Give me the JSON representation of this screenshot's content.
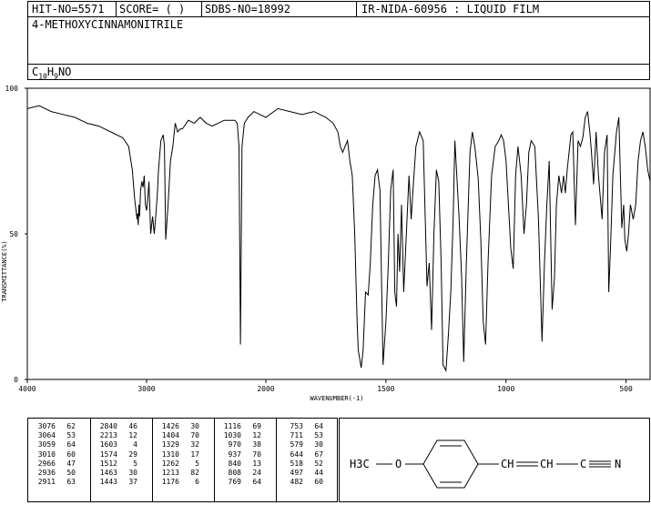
{
  "header": {
    "hit_no": "HIT-NO=5571",
    "score": "SCORE=  (   )",
    "sdbs_no": "SDBS-NO=18992",
    "ir_info": "IR-NIDA-60956 : LIQUID FILM",
    "compound_name": "4-METHOXYCINNAMONITRILE",
    "formula": {
      "c": "C",
      "c_n": "10",
      "h": "H",
      "h_n": "9",
      "rest": "NO"
    }
  },
  "chart_data": {
    "type": "line",
    "title": "",
    "xlabel": "WAVENUMBER(-1)",
    "ylabel": "TRANSMITTANCE(%)",
    "xlim": [
      4000,
      400
    ],
    "ylim": [
      0,
      100
    ],
    "x_ticks": [
      4000,
      3000,
      2000,
      1500,
      1000,
      500
    ],
    "y_ticks": [
      100,
      50,
      0
    ],
    "x_tick_labels": [
      "4000",
      "3000",
      "2000",
      "1500",
      "1000",
      "500"
    ],
    "y_tick_labels": [
      "100",
      "50",
      "0"
    ],
    "series": [
      {
        "x": [
          4000,
          3900,
          3800,
          3700,
          3600,
          3500,
          3400,
          3300,
          3200,
          3150,
          3120,
          3100,
          3080,
          3076,
          3070,
          3064,
          3059,
          3050,
          3040,
          3030,
          3020,
          3010,
          3000,
          2990,
          2980,
          2966,
          2960,
          2950,
          2936,
          2925,
          2911,
          2900,
          2880,
          2860,
          2850,
          2840,
          2820,
          2800,
          2780,
          2760,
          2740,
          2720,
          2700,
          2650,
          2600,
          2550,
          2500,
          2450,
          2400,
          2350,
          2300,
          2260,
          2240,
          2225,
          2213,
          2200,
          2180,
          2150,
          2100,
          2050,
          2000,
          1950,
          1900,
          1850,
          1800,
          1750,
          1720,
          1700,
          1690,
          1680,
          1670,
          1660,
          1650,
          1640,
          1630,
          1620,
          1615,
          1603,
          1595,
          1585,
          1574,
          1565,
          1555,
          1545,
          1535,
          1525,
          1512,
          1500,
          1490,
          1480,
          1470,
          1463,
          1456,
          1450,
          1443,
          1435,
          1426,
          1415,
          1404,
          1395,
          1385,
          1375,
          1360,
          1345,
          1329,
          1320,
          1310,
          1300,
          1290,
          1280,
          1270,
          1262,
          1250,
          1240,
          1230,
          1220,
          1213,
          1205,
          1195,
          1185,
          1176,
          1165,
          1150,
          1140,
          1130,
          1116,
          1105,
          1095,
          1085,
          1075,
          1060,
          1045,
          1030,
          1020,
          1010,
          1000,
          990,
          980,
          970,
          960,
          950,
          937,
          925,
          915,
          905,
          895,
          880,
          865,
          850,
          840,
          830,
          820,
          808,
          798,
          790,
          780,
          769,
          760,
          753,
          745,
          730,
          722,
          711,
          700,
          690,
          680,
          670,
          660,
          650,
          644,
          635,
          625,
          615,
          600,
          590,
          579,
          572,
          565,
          555,
          540,
          530,
          518,
          510,
          505,
          497,
          490,
          482,
          470,
          460,
          450,
          440,
          430,
          420,
          410,
          400
        ],
        "y": [
          93,
          94,
          92,
          91,
          90,
          88,
          87,
          85,
          83,
          80,
          72,
          62,
          55,
          57,
          53,
          60,
          56,
          65,
          68,
          66,
          70,
          60,
          58,
          62,
          68,
          50,
          52,
          56,
          50,
          55,
          63,
          72,
          82,
          84,
          80,
          48,
          60,
          75,
          80,
          88,
          85,
          86,
          86,
          89,
          88,
          90,
          88,
          87,
          88,
          89,
          89,
          89,
          88,
          80,
          12,
          80,
          88,
          90,
          92,
          91,
          90,
          93,
          92,
          91,
          92,
          90,
          88,
          85,
          80,
          78,
          80,
          82,
          75,
          70,
          50,
          20,
          10,
          4,
          10,
          30,
          29,
          40,
          60,
          70,
          72,
          65,
          5,
          20,
          40,
          65,
          72,
          30,
          25,
          50,
          37,
          60,
          30,
          50,
          70,
          55,
          68,
          80,
          85,
          82,
          32,
          40,
          17,
          50,
          72,
          68,
          40,
          5,
          3,
          15,
          30,
          55,
          82,
          70,
          55,
          35,
          6,
          40,
          78,
          85,
          80,
          69,
          48,
          20,
          12,
          40,
          70,
          80,
          82,
          84,
          82,
          75,
          60,
          45,
          38,
          70,
          80,
          70,
          50,
          60,
          78,
          82,
          80,
          55,
          13,
          40,
          60,
          75,
          24,
          35,
          60,
          70,
          64,
          70,
          64,
          72,
          84,
          85,
          53,
          82,
          80,
          83,
          90,
          92,
          84,
          78,
          67,
          85,
          70,
          55,
          78,
          84,
          30,
          45,
          70,
          85,
          90,
          52,
          60,
          48,
          44,
          50,
          60,
          55,
          60,
          75,
          82,
          85,
          80,
          72,
          68
        ]
      }
    ],
    "peak_table": {
      "columns": [
        [
          [
            "3076",
            "62"
          ],
          [
            "3064",
            "53"
          ],
          [
            "3059",
            "64"
          ],
          [
            "3010",
            "60"
          ],
          [
            "2966",
            "47"
          ],
          [
            "2936",
            "50"
          ],
          [
            "2911",
            "63"
          ]
        ],
        [
          [
            "2840",
            "46"
          ],
          [
            "2213",
            "12"
          ],
          [
            "1603",
            "4"
          ],
          [
            "1574",
            "29"
          ],
          [
            "1512",
            "5"
          ],
          [
            "1463",
            "30"
          ],
          [
            "1443",
            "37"
          ]
        ],
        [
          [
            "1426",
            "30"
          ],
          [
            "1404",
            "70"
          ],
          [
            "1329",
            "32"
          ],
          [
            "1310",
            "17"
          ],
          [
            "1262",
            "5"
          ],
          [
            "1213",
            "82"
          ],
          [
            "1176",
            "6"
          ]
        ],
        [
          [
            "1116",
            "69"
          ],
          [
            "1030",
            "12"
          ],
          [
            "970",
            "38"
          ],
          [
            "937",
            "70"
          ],
          [
            "840",
            "13"
          ],
          [
            "808",
            "24"
          ],
          [
            "769",
            "64"
          ]
        ],
        [
          [
            "753",
            "64"
          ],
          [
            "711",
            "53"
          ],
          [
            "579",
            "30"
          ],
          [
            "644",
            "67"
          ],
          [
            "518",
            "52"
          ],
          [
            "497",
            "44"
          ],
          [
            "482",
            "60"
          ]
        ]
      ]
    }
  },
  "structure": {
    "left_group": "H3C",
    "left_sub": "3",
    "oxygen": "O",
    "chain_1": "CH",
    "chain_2": "CH",
    "carbon": "C",
    "nitrogen": "N"
  }
}
